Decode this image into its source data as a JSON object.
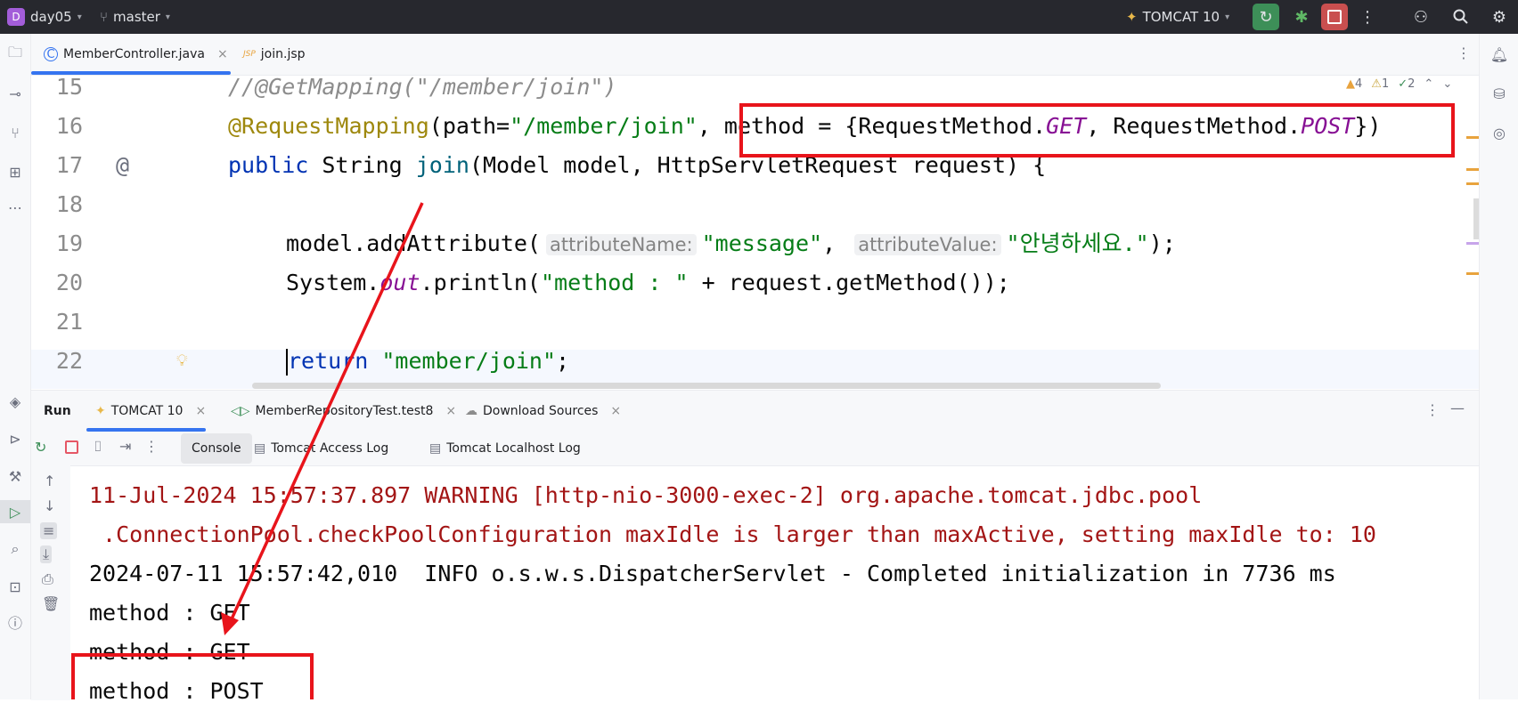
{
  "titlebar": {
    "project_badge": "D",
    "project": "day05",
    "branch": "master",
    "run_config": "TOMCAT 10"
  },
  "tabs": [
    {
      "icon": "C",
      "label": "MemberController.java",
      "close": "×"
    },
    {
      "icon": "JSP",
      "label": "join.jsp"
    }
  ],
  "inspections": {
    "warnings": "4",
    "weak": "1",
    "ok": "2"
  },
  "editor": {
    "line_numbers": [
      "15",
      "16",
      "17",
      "18",
      "19",
      "20",
      "21",
      "22"
    ],
    "gutter_annotation": "@",
    "l15": "//@GetMapping(\"/member/join\")",
    "l16": {
      "ann": "@RequestMapping",
      "p1": "(path=",
      "s1": "\"/member/join\"",
      "p2": ", method = {RequestMethod.",
      "get": "GET",
      "p3": ", RequestMethod.",
      "post": "POST",
      "p4": "})"
    },
    "l17": {
      "kw": "public",
      "p1": " String ",
      "fn": "join",
      "p2": "(Model model, HttpServletRequest request) {"
    },
    "l19": {
      "p1": "model.addAttribute(",
      "hint1": "attributeName:",
      "s1": "\"message\"",
      "p2": ", ",
      "hint2": "attributeValue:",
      "s2": "\"안녕하세요.\"",
      "p3": ");"
    },
    "l20": {
      "p1": "System.",
      "out": "out",
      "p2": ".println(",
      "s1": "\"method : \"",
      "p3": " + request.getMethod());"
    },
    "l22": {
      "kw": "return",
      "s1": " \"member/join\"",
      "p1": ";"
    }
  },
  "run": {
    "label": "Run",
    "tabs": [
      {
        "label": "TOMCAT 10",
        "close": "×"
      },
      {
        "label": "MemberRepositoryTest.test8",
        "close": "×"
      },
      {
        "label": "Download Sources",
        "close": "×"
      }
    ],
    "subtabs": [
      "Console",
      "Tomcat Access Log",
      "Tomcat Localhost Log"
    ]
  },
  "console": [
    "11-Jul-2024 15:57:37.897 WARNING [http-nio-3000-exec-2] org.apache.tomcat.jdbc.pool",
    " .ConnectionPool.checkPoolConfiguration maxIdle is larger than maxActive, setting maxIdle to: 10",
    "2024-07-11 15:57:42,010  INFO o.s.w.s.DispatcherServlet - Completed initialization in 7736 ms",
    "method : GET",
    "method : GET",
    "method : POST"
  ],
  "colors": {
    "highlight_box": "#e8141b",
    "warning_text": "#a31515",
    "active_tab_underline": "#3574f0"
  }
}
